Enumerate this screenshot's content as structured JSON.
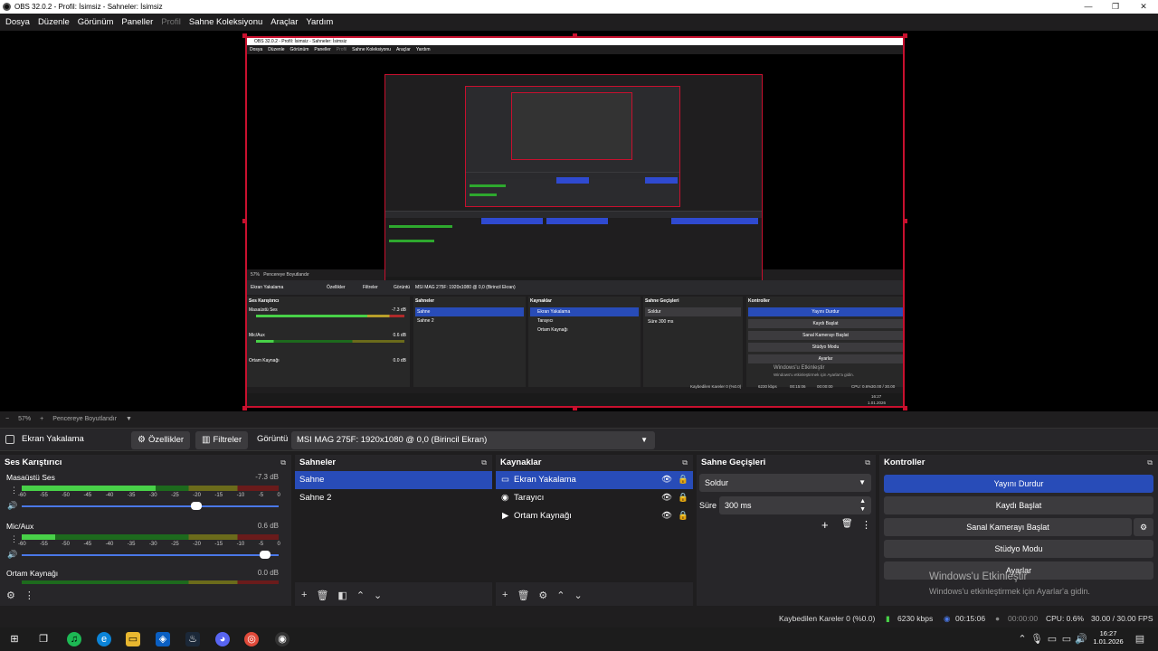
{
  "window": {
    "title": "OBS 32.0.2 - Profil: İsimsiz - Sahneler: İsimsiz",
    "min": "—",
    "max": "❐",
    "close": "✕"
  },
  "menu": [
    "Dosya",
    "Düzenle",
    "Görünüm",
    "Paneller",
    "Profil",
    "Sahne Koleksiyonu",
    "Araçlar",
    "Yardım"
  ],
  "nested": {
    "title": "OBS 32.0.2 - Profil: İsimsiz - Sahneler: İsimsiz",
    "menu": [
      "Dosya",
      "Düzenle",
      "Görünüm",
      "Paneller",
      "Profil",
      "Sahne Koleksiyonu",
      "Araçlar",
      "Yardım"
    ],
    "zoom": "57%",
    "fit": "Pencereye Boyutlandır",
    "source": "Ekran Yakalama",
    "props": "Özellikler",
    "filters": "Filtreler",
    "display": "Görüntü",
    "display_value": "MSI MAG 275F: 1920x1080 @ 0,0 (Birincil Ekran)",
    "mixer": "Ses Karıştırıcı",
    "scenes": "Sahneler",
    "sources": "Kaynaklar",
    "transitions": "Sahne Geçişleri",
    "controls": "Kontroller",
    "scene1": "Sahne",
    "scene2": "Sahne 2",
    "src1": "Ekran Yakalama",
    "src2": "Tarayıcı",
    "src3": "Ortam Kaynağı",
    "fade": "Soldur",
    "dur": "Süre",
    "dur_value": "300 ms",
    "btn_stream": "Yayını Durdur",
    "btn_rec": "Kaydı Başlat",
    "btn_vcam": "Sanal Kamerayı Başlat",
    "btn_studio": "Stüdyo Modu",
    "btn_settings": "Ayarlar",
    "ch1": "Masaüstü Ses",
    "ch1_db": "-7.3 dB",
    "ch2": "Mic/Aux",
    "ch2_db": "0.6 dB",
    "ch3": "Ortam Kaynağı",
    "ch3_db": "0.0 dB",
    "wm1": "Windows'u Etkinleştir",
    "wm2": "Windows'u etkinleştirmek için Ayarlar'a gidin.",
    "status": "Kaybedilen Kareler 0 (%0.0)",
    "kbps": "6230 kbps",
    "time": "00:15:06",
    "rec": "00:00:00",
    "cpu": "CPU: 0.6%",
    "fps": "30.00 / 30.00 FPS",
    "clock": "16:27",
    "date": "1.01.2026"
  },
  "preview_bar": {
    "zoom_out": "−",
    "zoom": "57%",
    "zoom_in": "+",
    "fit": "Pencereye Boyutlandır",
    "dropdown": "▼"
  },
  "source_bar": {
    "source_name": "Ekran Yakalama",
    "properties": "Özellikler",
    "filters": "Filtreler",
    "display_label": "Görüntü",
    "display_value": "MSI MAG 275F: 1920x1080 @ 0,0 (Birincil Ekran)"
  },
  "docks": {
    "mixer": {
      "title": "Ses Karıştırıcı",
      "channels": [
        {
          "name": "Masaüstü Ses",
          "db": "-7.3 dB",
          "level": 0.52,
          "volume": 0.7
        },
        {
          "name": "Mic/Aux",
          "db": "0.6 dB",
          "level": 0.13,
          "volume": 0.97
        },
        {
          "name": "Ortam Kaynağı",
          "db": "0.0 dB",
          "level": 0.0,
          "volume": 1.0
        }
      ],
      "ticks": [
        "-60",
        "-55",
        "-50",
        "-45",
        "-40",
        "-35",
        "-30",
        "-25",
        "-20",
        "-15",
        "-10",
        "-5",
        "0"
      ]
    },
    "scenes": {
      "title": "Sahneler",
      "items": [
        "Sahne",
        "Sahne 2"
      ],
      "selected": 0
    },
    "sources": {
      "title": "Kaynaklar",
      "items": [
        "Ekran Yakalama",
        "Tarayıcı",
        "Ortam Kaynağı"
      ],
      "selected": 0
    },
    "transitions": {
      "title": "Sahne Geçişleri",
      "type": "Soldur",
      "duration_label": "Süre",
      "duration": "300 ms"
    },
    "controls": {
      "title": "Kontroller",
      "stream": "Yayını Durdur",
      "record": "Kaydı Başlat",
      "vcam": "Sanal Kamerayı Başlat",
      "studio": "Stüdyo Modu",
      "settings": "Ayarlar"
    }
  },
  "watermark": {
    "line1": "Windows'u Etkinleştir",
    "line2": "Windows'u etkinleştirmek için Ayarlar'a gidin."
  },
  "status": {
    "dropped": "Kaybedilen Kareler 0 (%0.0)",
    "bitrate": "6230 kbps",
    "stream_time": "00:15:06",
    "rec_time": "00:00:00",
    "cpu": "CPU: 0.6%",
    "fps": "30.00 / 30.00 FPS"
  },
  "taskbar": {
    "time": "16:27",
    "date": "1.01.2026"
  }
}
